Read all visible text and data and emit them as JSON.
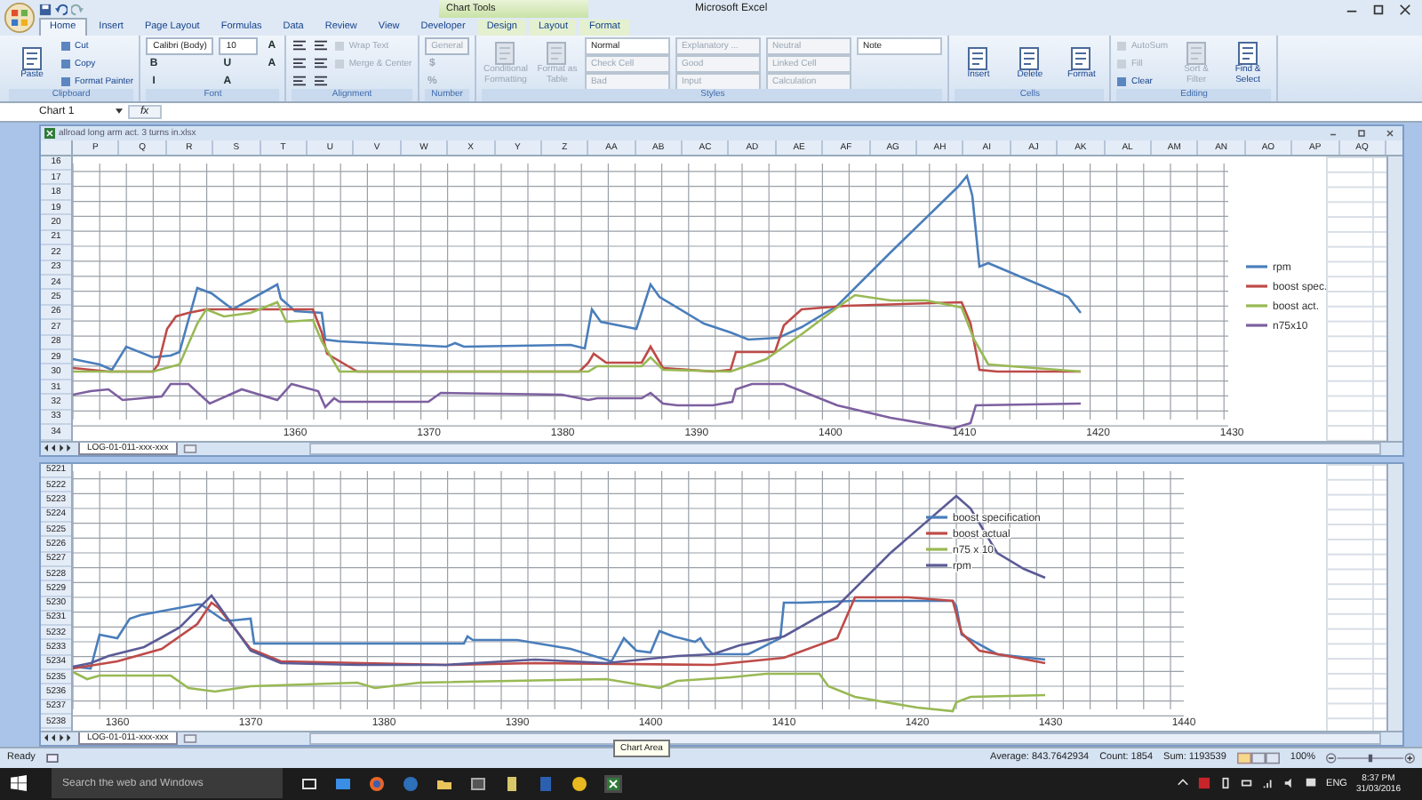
{
  "app": {
    "title": "Microsoft Excel",
    "context_tab": "Chart Tools"
  },
  "ribbon_tabs": [
    {
      "label": "Home",
      "selected": true,
      "contextual": false
    },
    {
      "label": "Insert",
      "selected": false,
      "contextual": false
    },
    {
      "label": "Page Layout",
      "selected": false,
      "contextual": false
    },
    {
      "label": "Formulas",
      "selected": false,
      "contextual": false
    },
    {
      "label": "Data",
      "selected": false,
      "contextual": false
    },
    {
      "label": "Review",
      "selected": false,
      "contextual": false
    },
    {
      "label": "View",
      "selected": false,
      "contextual": false
    },
    {
      "label": "Developer",
      "selected": false,
      "contextual": false
    },
    {
      "label": "Design",
      "selected": false,
      "contextual": true
    },
    {
      "label": "Layout",
      "selected": false,
      "contextual": true
    },
    {
      "label": "Format",
      "selected": false,
      "contextual": true
    }
  ],
  "ribbon_groups": [
    {
      "label": "Clipboard",
      "items": [
        {
          "kind": "large",
          "label": "Paste",
          "disabled": false
        },
        {
          "kind": "small",
          "label": "Cut",
          "disabled": false
        },
        {
          "kind": "small",
          "label": "Copy",
          "disabled": false
        },
        {
          "kind": "small",
          "label": "Format Painter",
          "disabled": false
        }
      ]
    },
    {
      "label": "Font",
      "items": [
        {
          "kind": "field",
          "label": "Calibri (Body)",
          "disabled": false
        },
        {
          "kind": "glyph",
          "label": "B",
          "disabled": false
        },
        {
          "kind": "glyph",
          "label": "I",
          "disabled": false
        },
        {
          "kind": "field",
          "label": "10",
          "disabled": false
        },
        {
          "kind": "glyph",
          "label": "U",
          "disabled": false
        },
        {
          "kind": "glyph",
          "label": "A",
          "disabled": false
        },
        {
          "kind": "glyph",
          "label": "A",
          "disabled": false
        },
        {
          "kind": "glyph",
          "label": "A",
          "disabled": false
        }
      ]
    },
    {
      "label": "Alignment",
      "items": [
        {
          "kind": "icon",
          "disabled": false
        },
        {
          "kind": "icon",
          "disabled": false
        },
        {
          "kind": "icon",
          "disabled": false
        },
        {
          "kind": "icon",
          "disabled": false
        },
        {
          "kind": "icon",
          "disabled": false
        },
        {
          "kind": "icon",
          "disabled": false
        },
        {
          "kind": "small",
          "label": "Wrap Text",
          "disabled": true
        },
        {
          "kind": "small",
          "label": "Merge & Center",
          "disabled": true
        }
      ]
    },
    {
      "label": "Number",
      "items": [
        {
          "kind": "field",
          "label": "General",
          "disabled": true
        },
        {
          "kind": "glyph",
          "label": "$",
          "disabled": true
        },
        {
          "kind": "glyph",
          "label": "%",
          "disabled": true
        }
      ]
    },
    {
      "label": "Styles",
      "items": [
        {
          "kind": "large",
          "label": "Conditional Formatting",
          "disabled": true
        },
        {
          "kind": "large",
          "label": "Format as Table",
          "disabled": true
        },
        {
          "kind": "style",
          "label": "Normal",
          "disabled": false
        },
        {
          "kind": "style",
          "label": "Check Cell",
          "disabled": true
        },
        {
          "kind": "style",
          "label": "Bad",
          "disabled": true
        },
        {
          "kind": "style",
          "label": "Explanatory ...",
          "disabled": true
        },
        {
          "kind": "style",
          "label": "Good",
          "disabled": true
        },
        {
          "kind": "style",
          "label": "Input",
          "disabled": true
        },
        {
          "kind": "style",
          "label": "Neutral",
          "disabled": true
        },
        {
          "kind": "style",
          "label": "Linked Cell",
          "disabled": true
        },
        {
          "kind": "style",
          "label": "Calculation",
          "disabled": true
        },
        {
          "kind": "style",
          "label": "Note",
          "disabled": false
        }
      ]
    },
    {
      "label": "Cells",
      "items": [
        {
          "kind": "large",
          "label": "Insert",
          "disabled": false
        },
        {
          "kind": "large",
          "label": "Delete",
          "disabled": false
        },
        {
          "kind": "large",
          "label": "Format",
          "disabled": false
        }
      ]
    },
    {
      "label": "Editing",
      "items": [
        {
          "kind": "small",
          "label": "AutoSum",
          "disabled": true
        },
        {
          "kind": "small",
          "label": "Fill",
          "disabled": true
        },
        {
          "kind": "small",
          "label": "Clear",
          "disabled": false
        },
        {
          "kind": "large",
          "label": "Sort & Filter",
          "disabled": true
        },
        {
          "kind": "large",
          "label": "Find & Select",
          "disabled": false
        }
      ]
    }
  ],
  "formula_bar": {
    "name_box": "Chart 1",
    "fx": "fx"
  },
  "windows": [
    {
      "title": "allroad long arm act. 3 turns in.xlsx",
      "columns": [
        "P",
        "Q",
        "R",
        "S",
        "T",
        "U",
        "V",
        "W",
        "X",
        "Y",
        "Z",
        "AA",
        "AB",
        "AC",
        "AD",
        "AE",
        "AF",
        "AG",
        "AH",
        "AI",
        "AJ",
        "AK",
        "AL",
        "AM",
        "AN",
        "AO",
        "AP",
        "AQ"
      ],
      "rows": [
        "16",
        "17",
        "18",
        "19",
        "20",
        "21",
        "22",
        "23",
        "24",
        "25",
        "26",
        "27",
        "28",
        "29",
        "30",
        "31",
        "32",
        "33",
        "34"
      ],
      "chart": {
        "xticks": [
          "1360",
          "1370",
          "1380",
          "1390",
          "1400",
          "1410",
          "1420",
          "1430"
        ],
        "legend": [
          {
            "label": "rpm",
            "color": "#4a7ebb"
          },
          {
            "label": "boost spec.",
            "color": "#be4b48"
          },
          {
            "label": "boost act.",
            "color": "#98b954"
          },
          {
            "label": "n75x10",
            "color": "#7d60a0"
          }
        ]
      },
      "sheet_tab": "LOG-01-011-xxx-xxx"
    },
    {
      "rows": [
        "5221",
        "5222",
        "5223",
        "5224",
        "5225",
        "5226",
        "5227",
        "5228",
        "5229",
        "5230",
        "5231",
        "5232",
        "5233",
        "5234",
        "5235",
        "5236",
        "5237",
        "5238"
      ],
      "chart": {
        "xticks": [
          "1360",
          "1370",
          "1380",
          "1390",
          "1400",
          "1410",
          "1420",
          "1430",
          "1440"
        ],
        "legend": [
          {
            "label": "boost specification",
            "color": "#4a7ebb"
          },
          {
            "label": "boost actual",
            "color": "#be4b48"
          },
          {
            "label": "n75 x 10",
            "color": "#98b954"
          },
          {
            "label": "rpm",
            "color": "#5b5b96"
          }
        ]
      },
      "sheet_tab": "LOG-01-011-xxx-xxx"
    }
  ],
  "status_bar": {
    "mode": "Ready",
    "stats": [
      "Average: 843.7642934",
      "Count: 1854",
      "Sum: 1193539"
    ],
    "zoom": "100%",
    "zoom_slider": {
      "level": 0.5
    }
  },
  "tooltip": "Chart Area",
  "taskbar": {
    "search": {
      "placeholder": "Search the web and Windows"
    },
    "language": "ENG",
    "time": "8:37 PM",
    "date": "31/03/2016"
  }
}
